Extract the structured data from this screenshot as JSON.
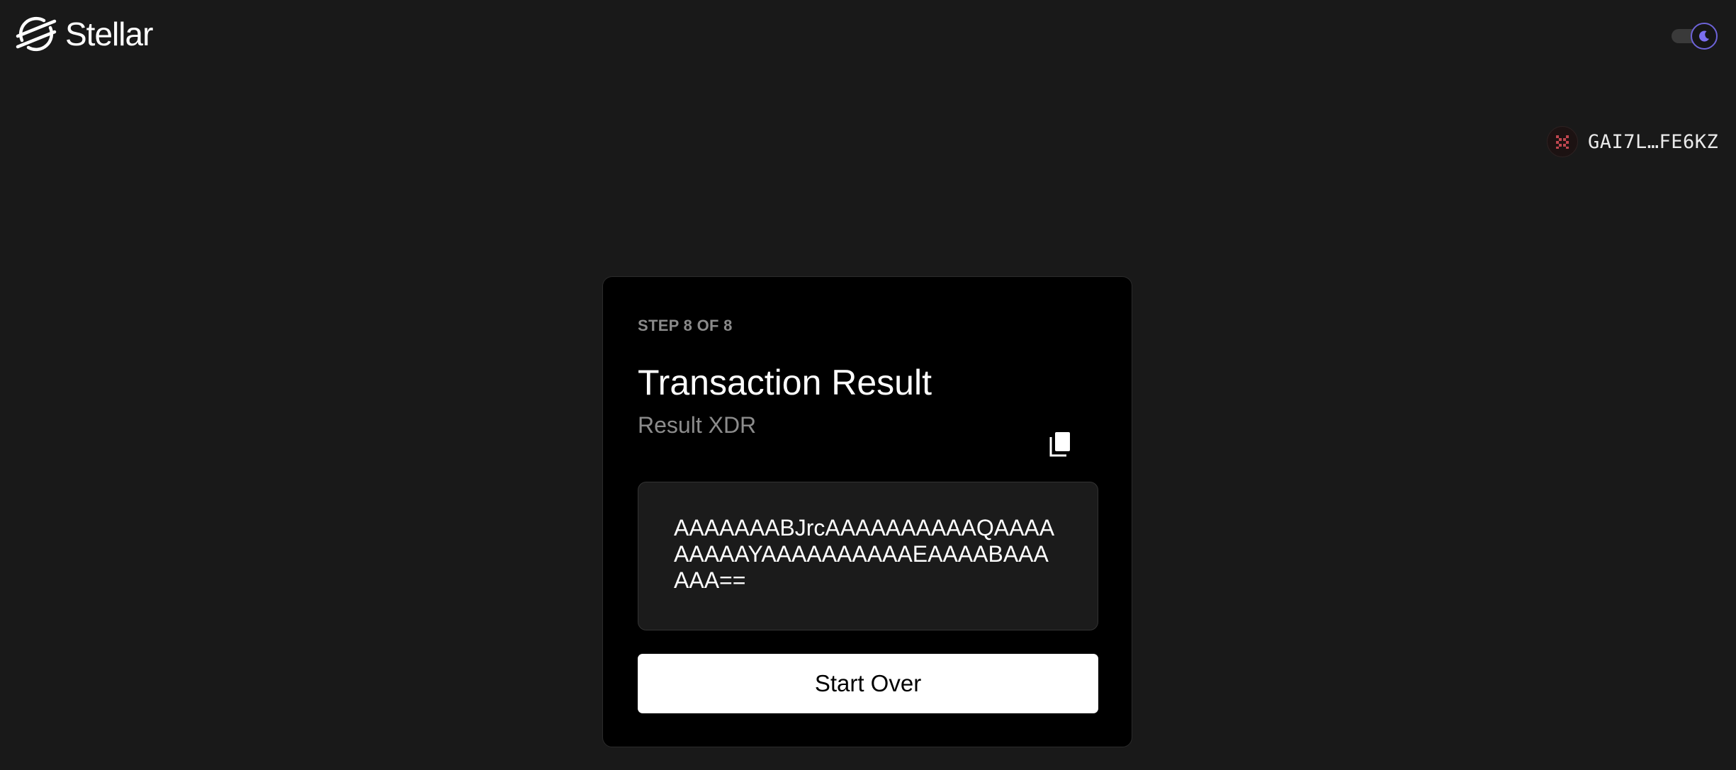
{
  "header": {
    "brand": "Stellar",
    "logo_icon": "stellar-logo-icon",
    "theme_toggle_icon": "moon-icon",
    "theme_mode": "dark",
    "accent_color": "#6d63d8"
  },
  "account": {
    "address": "GAI7L…FE6KZ",
    "avatar_icon": "identicon-avatar"
  },
  "card": {
    "step": "STEP 8 OF 8",
    "title": "Transaction Result",
    "subtitle": "Result XDR",
    "copy_icon": "copy-icon",
    "xdr": "AAAAAAABJrcAAAAAAAAAAQAAAAAAAAAYAAAAAAAAAAEAAAABAAAAAA==",
    "button_label": "Start Over"
  }
}
